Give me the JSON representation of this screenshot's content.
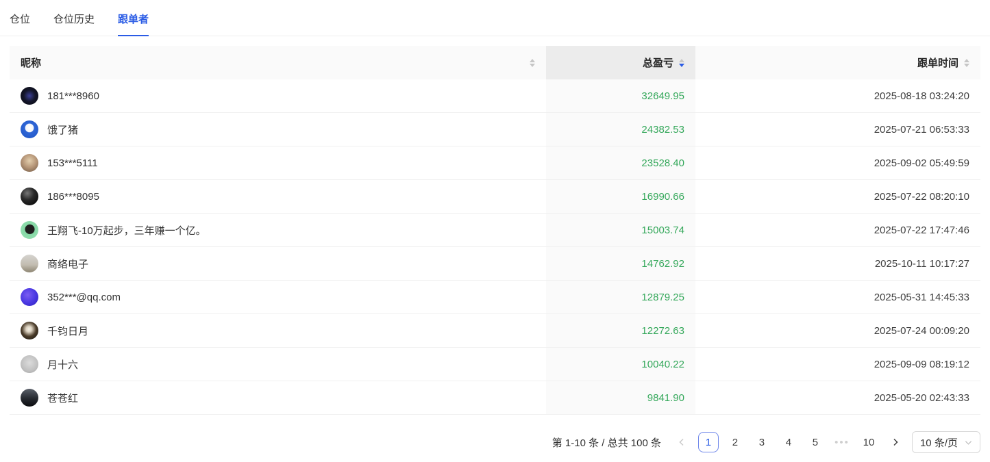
{
  "tabs": [
    {
      "label": "仓位",
      "active": false
    },
    {
      "label": "仓位历史",
      "active": false
    },
    {
      "label": "跟单者",
      "active": true
    }
  ],
  "colors": {
    "accent_blue": "#2b5ce5",
    "profit_green": "#35a85b",
    "header_bg": "#fafafa",
    "sorted_header_bg": "#ececec",
    "sorted_body_bg": "#fafafa"
  },
  "table": {
    "columns": [
      {
        "label": "昵称",
        "align": "left",
        "sortable": true,
        "sort": "none"
      },
      {
        "label": "总盈亏",
        "align": "right",
        "sortable": true,
        "sort": "desc"
      },
      {
        "label": "跟单时间",
        "align": "right",
        "sortable": true,
        "sort": "none"
      }
    ],
    "sort_state": {
      "column": "总盈亏",
      "direction": "desc"
    },
    "rows": [
      {
        "nickname": "181***8960",
        "pnl": "32649.95",
        "time": "2025-08-18 03:24:20",
        "avatar": "dark-blue-cross",
        "avatar_bg": "background:radial-gradient(circle at 50% 50%, #3b3f96 0%, #14162b 45%, #06070c 100%)"
      },
      {
        "nickname": "饿了猪",
        "pnl": "24382.53",
        "time": "2025-07-21 06:53:33",
        "avatar": "blue-cartoon-face",
        "avatar_bg": "background:radial-gradient(circle at 50% 42%, #ffffff 0%, #f4f6fb 30%, #2f66d6 34%, #1d53c4 100%)"
      },
      {
        "nickname": "153***5111",
        "pnl": "23528.40",
        "time": "2025-09-02 05:49:59",
        "avatar": "portrait-photo",
        "avatar_bg": "background:radial-gradient(circle at 50% 38%, #e3cfae 0%, #b69678 48%, #6e5742 100%)"
      },
      {
        "nickname": "186***8095",
        "pnl": "16990.66",
        "time": "2025-07-22 08:20:10",
        "avatar": "black-glossy-ring",
        "avatar_bg": "background:radial-gradient(circle at 38% 32%, #777777 0%, #2a2a2a 40%, #000000 100%)"
      },
      {
        "nickname": "王翔飞-10万起步，三年赚一个亿。",
        "pnl": "15003.74",
        "time": "2025-07-22 17:47:46",
        "avatar": "horse-on-mint-green",
        "avatar_bg": "background:radial-gradient(circle at 52% 46%, #1e1e1e 0%, #1e1e1e 34%, #86d8a6 38%, #97e0b2 100%)"
      },
      {
        "nickname": "商络电子",
        "pnl": "14762.92",
        "time": "2025-10-11 10:17:27",
        "avatar": "gray-landscape-photo",
        "avatar_bg": "background:linear-gradient(180deg, #d6d4d0 0%, #c2bcb0 58%, #8e8673 100%)"
      },
      {
        "nickname": "352***@qq.com",
        "pnl": "12879.25",
        "time": "2025-05-31 14:45:33",
        "avatar": "purple-marble",
        "avatar_bg": "background:radial-gradient(circle at 40% 38%, #7a5df2 0%, #4a38e2 52%, #2c20ba 100%)"
      },
      {
        "nickname": "千钧日月",
        "pnl": "12272.63",
        "time": "2025-07-24 00:09:20",
        "avatar": "moon-on-dark",
        "avatar_bg": "background:radial-gradient(circle at 47% 42%, #f6f2e7 0%, #ddd3c2 20%, #4a3b29 52%, #120e09 100%)"
      },
      {
        "nickname": "月十六",
        "pnl": "10040.22",
        "time": "2025-09-09 08:19:12",
        "avatar": "light-gray-photo",
        "avatar_bg": "background:radial-gradient(circle at 50% 42%, #dcdcdc 0%, #c0c0c0 60%, #9c9c9c 100%)"
      },
      {
        "nickname": "苍苍红",
        "pnl": "9841.90",
        "time": "2025-05-20 02:43:33",
        "avatar": "dark-seascape-figure",
        "avatar_bg": "background:linear-gradient(180deg, #5b616a 0%, #262a30 55%, #0b0c0f 100%)"
      }
    ]
  },
  "pagination": {
    "total_text": "第 1-10 条 / 总共 100 条",
    "prev_label": "previous-page",
    "next_label": "next-page",
    "pages": [
      "1",
      "2",
      "3",
      "4",
      "5"
    ],
    "ellipsis": "•••",
    "last_page": "10",
    "active_page": "1",
    "page_size_label": "10 条/页"
  }
}
